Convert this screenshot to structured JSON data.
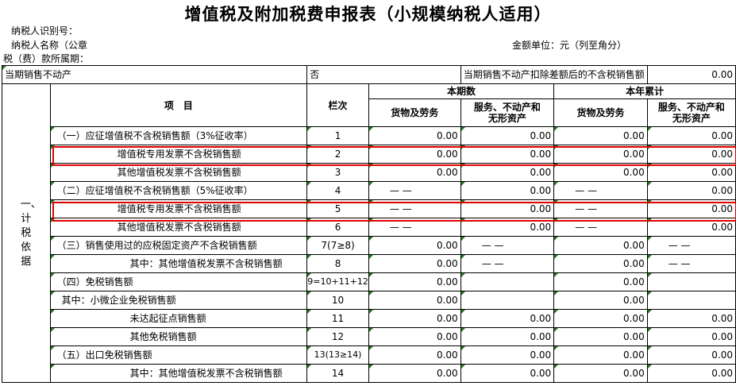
{
  "title": "增值税及附加税费申报表（小规模纳税人适用）",
  "header": {
    "taxpayer_id_label": "纳税人识别号：",
    "taxpayer_name_label": "纳税人名称（公章",
    "unit_label": "金额单位：元（列至角分）",
    "period_label": "税（费）款所属期："
  },
  "real_estate_row": {
    "label": "当期销售不动产",
    "value": "否",
    "deduct_label": "当期销售不动产扣除差额后的不含税销售额",
    "deduct_value": "0.00"
  },
  "columns": {
    "item": "项　目",
    "line_no": "栏次",
    "current_period": "本期数",
    "ytd": "本年累计",
    "goods": "货物及劳务",
    "services_line1": "服务、不动产和",
    "services_line2": "无形资产"
  },
  "side_label": "一、计税依据",
  "rows": [
    {
      "label": "（一）应征增值税不含税销售额（3%征收率）",
      "line": "1",
      "c1": "0.00",
      "c2": "0.00",
      "c3": "0.00",
      "c4": "0.00"
    },
    {
      "label": "增值税专用发票不含税销售额",
      "line": "2",
      "c1": "0.00",
      "c2": "0.00",
      "c3": "0.00",
      "c4": "0.00"
    },
    {
      "label": "其他增值税发票不含税销售额",
      "line": "3",
      "c1": "0.00",
      "c2": "0.00",
      "c3": "0.00",
      "c4": "0.00"
    },
    {
      "label": "（二）应征增值税不含税销售额（5%征收率）",
      "line": "4",
      "c1": "— —",
      "c2": "0.00",
      "c3": "— —",
      "c4": "0.00"
    },
    {
      "label": "增值税专用发票不含税销售额",
      "line": "5",
      "c1": "— —",
      "c2": "0.00",
      "c3": "— —",
      "c4": "0.00"
    },
    {
      "label": "其他增值税发票不含税销售额",
      "line": "6",
      "c1": "— —",
      "c2": "0.00",
      "c3": "— —",
      "c4": "0.00"
    },
    {
      "label": "（三）销售使用过的应税固定资产不含税销售额",
      "line": "7(7≥8)",
      "c1": "0.00",
      "c2": "— —",
      "c3": "0.00",
      "c4": "— —"
    },
    {
      "label": "其中：其他增值税发票不含税销售额",
      "line": "8",
      "c1": "0.00",
      "c2": "— —",
      "c3": "0.00",
      "c4": "— —"
    },
    {
      "label": "（四）免税销售额",
      "line": "9=10+11+12",
      "c1": "0.00",
      "c2": "",
      "c3": "0.00",
      "c4": ""
    },
    {
      "label": "其中：小微企业免税销售额",
      "line": "10",
      "c1": "0.00",
      "c2": "",
      "c3": "0.00",
      "c4": ""
    },
    {
      "label": "未达起征点销售额",
      "line": "11",
      "c1": "0.00",
      "c2": "0.00",
      "c3": "0.00",
      "c4": "0.00"
    },
    {
      "label": "其他免税销售额",
      "line": "12",
      "c1": "0.00",
      "c2": "0.00",
      "c3": "0.00",
      "c4": "0.00"
    },
    {
      "label": "（五）出口免税销售额",
      "line": "13(13≥14)",
      "c1": "0.00",
      "c2": "0.00",
      "c3": "0.00",
      "c4": "0.00"
    },
    {
      "label": "其中：其他增值税发票不含税销售额",
      "line": "14",
      "c1": "0.00",
      "c2": "0.00",
      "c3": "0.00",
      "c4": "0.00"
    }
  ],
  "colors": {
    "highlight": "#e00000",
    "cell_marker": "#1f7a1f"
  }
}
